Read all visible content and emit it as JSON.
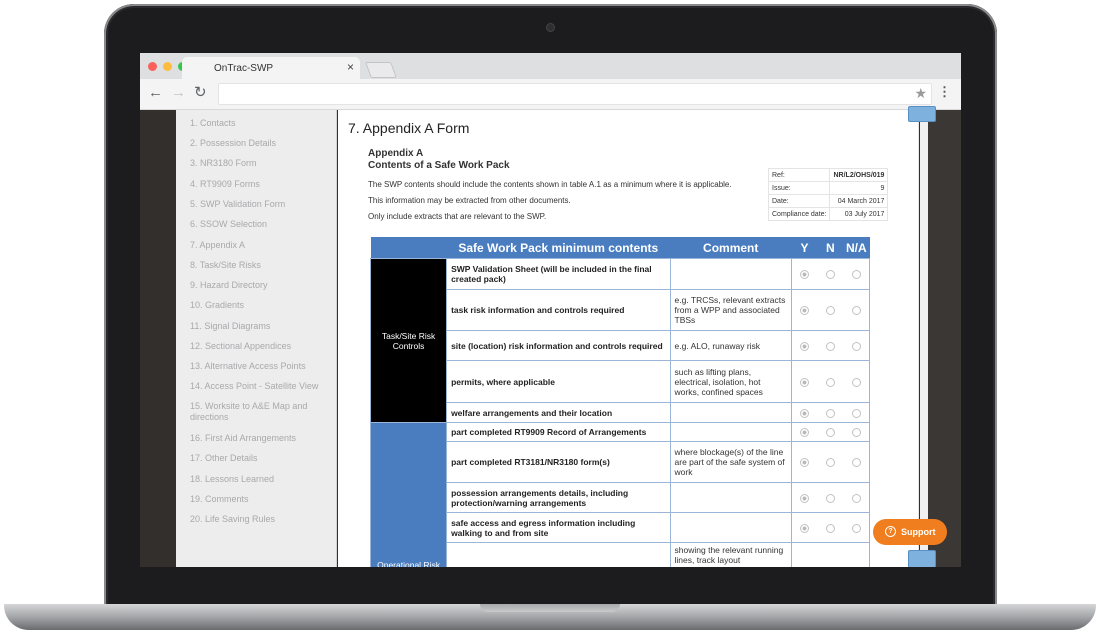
{
  "browser": {
    "tab_title": "OnTrac-SWP",
    "tab_close": "×",
    "back_icon": "←",
    "forward_icon": "→",
    "reload_icon": "↻",
    "star_icon": "★",
    "menu_icon": "⋮"
  },
  "sidebar": {
    "items": [
      {
        "label": "1. Contacts"
      },
      {
        "label": "2. Possession Details"
      },
      {
        "label": "3. NR3180 Form"
      },
      {
        "label": "4. RT9909 Forms"
      },
      {
        "label": "5. SWP Validation Form"
      },
      {
        "label": "6. SSOW Selection"
      },
      {
        "label": "7. Appendix A"
      },
      {
        "label": "8. Task/Site Risks"
      },
      {
        "label": "9. Hazard Directory"
      },
      {
        "label": "10. Gradients"
      },
      {
        "label": "11. Signal Diagrams"
      },
      {
        "label": "12. Sectional Appendices"
      },
      {
        "label": "13. Alternative Access Points"
      },
      {
        "label": "14. Access Point - Satellite View"
      },
      {
        "label": "15. Worksite to A&E Map and directions"
      },
      {
        "label": "16. First Aid Arrangements"
      },
      {
        "label": "17. Other Details"
      },
      {
        "label": "18. Lessons Learned"
      },
      {
        "label": "19. Comments"
      },
      {
        "label": "20. Life Saving Rules"
      }
    ]
  },
  "main": {
    "page_title": "7. Appendix A Form",
    "appendix_title": "Appendix A",
    "appendix_subtitle": "Contents of a Safe Work Pack",
    "paragraphs": [
      "The SWP contents should include the contents shown in table A.1 as a minimum where it is applicable.",
      "This information may be extracted from other documents.",
      "Only include extracts that are relevant to the SWP."
    ],
    "ref_table": [
      {
        "label": "Ref:",
        "value": "NR/L2/OHS/019"
      },
      {
        "label": "Issue:",
        "value": "9"
      },
      {
        "label": "Date:",
        "value": "04 March 2017"
      },
      {
        "label": "Compliance date:",
        "value": "03 July 2017"
      }
    ],
    "table": {
      "headers": {
        "contents": "Safe Work Pack minimum contents",
        "comment": "Comment",
        "y": "Y",
        "n": "N",
        "na": "N/A"
      },
      "categories": [
        {
          "label": "Task/Site Risk Controls",
          "color": "#000000"
        },
        {
          "label": "Operational Risk",
          "color": "#4a7dc0"
        }
      ],
      "rows": [
        {
          "item": "SWP Validation Sheet (will be included in the final created pack)",
          "comment": ""
        },
        {
          "item": "task risk information and controls required",
          "comment": "e.g. TRCSs, relevant extracts from a WPP and associated TBSs"
        },
        {
          "item": "site (location) risk information and controls required",
          "comment": "e.g. ALO, runaway risk"
        },
        {
          "item": "permits, where applicable",
          "comment": "such as lifting plans, electrical, isolation, hot works, confined spaces"
        },
        {
          "item": "welfare arrangements and their location",
          "comment": ""
        },
        {
          "item": "part completed RT9909 Record of Arrangements",
          "comment": ""
        },
        {
          "item": "part completed RT3181/NR3180 form(s)",
          "comment": "where blockage(s) of the line are part of the safe system of work"
        },
        {
          "item": "possession arrangements details, including protection/warning arrangements",
          "comment": ""
        },
        {
          "item": "safe access and egress information including walking to and from site",
          "comment": ""
        },
        {
          "item": "",
          "comment": "showing the relevant running lines, track layout"
        }
      ]
    }
  },
  "support": {
    "label": "Support",
    "icon": "?"
  }
}
